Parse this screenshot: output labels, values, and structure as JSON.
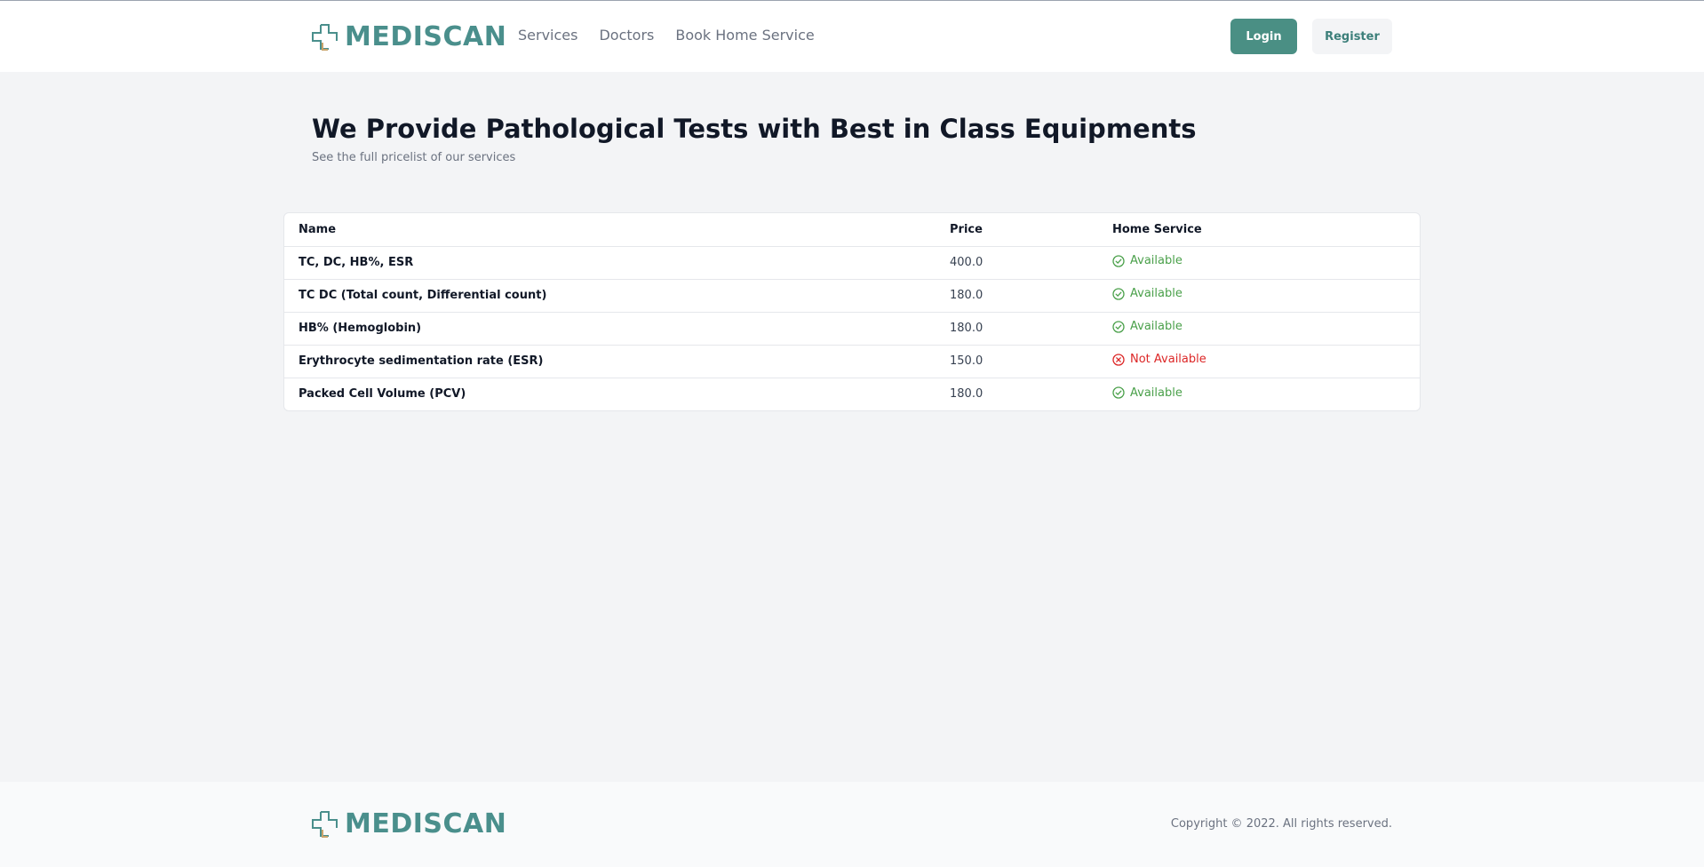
{
  "brand": {
    "name": "MEDISCAN",
    "icon": "medical-cross-logo-icon",
    "color": "#4a8f8c"
  },
  "nav": {
    "items": [
      "Services",
      "Doctors",
      "Book Home Service"
    ]
  },
  "auth": {
    "login_label": "Login",
    "register_label": "Register"
  },
  "hero": {
    "title": "We Provide Pathological Tests with Best in Class Equipments",
    "subtitle": "See the full pricelist of our services"
  },
  "table": {
    "columns": [
      "Name",
      "Price",
      "Home Service"
    ],
    "rows": [
      {
        "name": "TC, DC, HB%, ESR",
        "price": "400.0",
        "home_service": "Available",
        "available": true
      },
      {
        "name": "TC DC (Total count, Differential count)",
        "price": "180.0",
        "home_service": "Available",
        "available": true
      },
      {
        "name": "HB% (Hemoglobin)",
        "price": "180.0",
        "home_service": "Available",
        "available": true
      },
      {
        "name": "Erythrocyte sedimentation rate (ESR)",
        "price": "150.0",
        "home_service": "Not Available",
        "available": false
      },
      {
        "name": "Packed Cell Volume (PCV)",
        "price": "180.0",
        "home_service": "Available",
        "available": true
      }
    ]
  },
  "colors": {
    "available": "#4aa04a",
    "not_available": "#dc2626",
    "accent": "#4a8f84"
  },
  "footer": {
    "copyright": "Copyright © 2022. All rights reserved."
  }
}
